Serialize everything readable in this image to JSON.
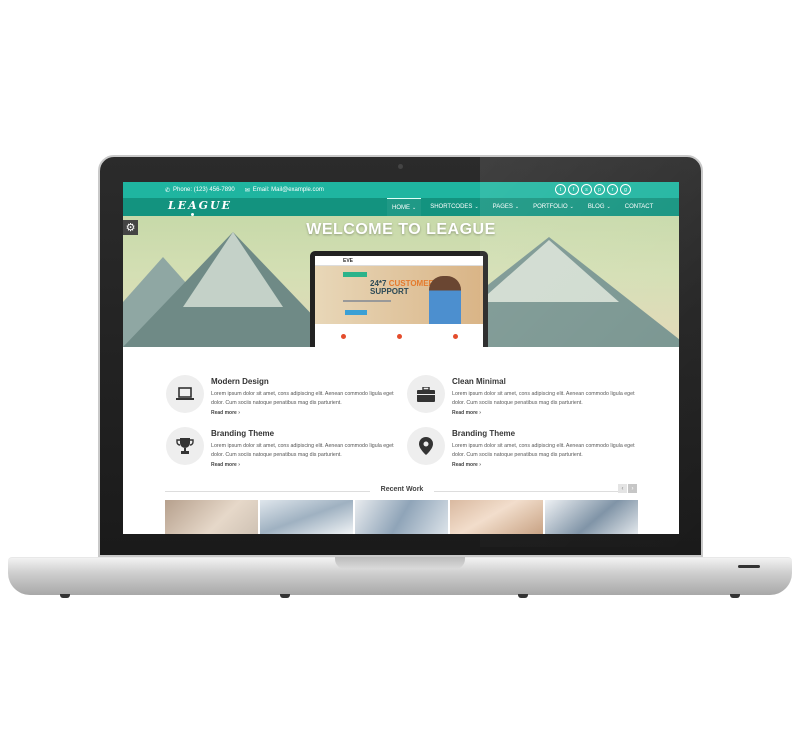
{
  "topbar": {
    "phone": "Phone: (123) 456-7890",
    "email": "Email: Mail@example.com",
    "socials": [
      "twitter-icon",
      "facebook-icon",
      "skype-icon",
      "pinterest-icon",
      "rss-icon",
      "google-plus-icon"
    ]
  },
  "brand": {
    "logo": "LEAGUE"
  },
  "nav": {
    "items": [
      {
        "label": "HOME",
        "active": true
      },
      {
        "label": "SHORTCODES"
      },
      {
        "label": "PAGES"
      },
      {
        "label": "PORTFOLIO"
      },
      {
        "label": "BLOG"
      },
      {
        "label": "CONTACT"
      }
    ]
  },
  "hero": {
    "title": "WELCOME TO LEAGUE",
    "mockup": {
      "logo": "EVE",
      "headline_part1": "24*7",
      "headline_part2": "CUSTOMER",
      "headline_part3": "SUPPORT"
    }
  },
  "features": [
    {
      "title": "Modern Design",
      "icon": "laptop-icon",
      "desc": "Lorem ipsum dolor sit amet, cons adipiscing elit. Aenean commodo ligula eget dolor. Cum sociis natoque penatibus mag dis parturient.",
      "more": "Read more"
    },
    {
      "title": "Clean Minimal",
      "icon": "briefcase-icon",
      "desc": "Lorem ipsum dolor sit amet, cons adipiscing elit. Aenean commodo ligula eget dolor. Cum sociis natoque penatibus mag dis parturient.",
      "more": "Read more"
    },
    {
      "title": "Branding Theme",
      "icon": "trophy-icon",
      "desc": "Lorem ipsum dolor sit amet, cons adipiscing elit. Aenean commodo ligula eget dolor. Cum sociis natoque penatibus mag dis parturient.",
      "more": "Read more"
    },
    {
      "title": "Branding Theme",
      "icon": "map-pin-icon",
      "desc": "Lorem ipsum dolor sit amet, cons adipiscing elit. Aenean commodo ligula eget dolor. Cum sociis natoque penatibus mag dis parturient.",
      "more": "Read more"
    }
  ],
  "recent_work": {
    "title": "Recent Work"
  },
  "colors": {
    "accent": "#1fb5a0",
    "nav": "#13937f"
  }
}
